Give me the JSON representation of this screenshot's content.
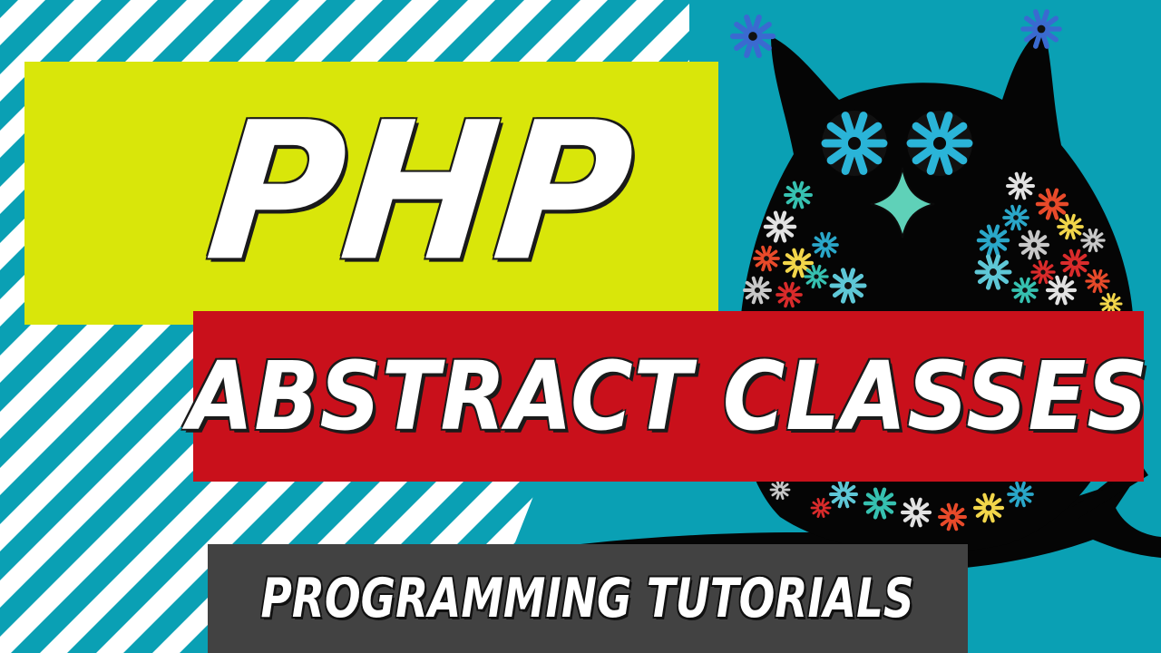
{
  "thumbnail": {
    "title_line1": "PHP",
    "title_line2": "ABSTRACT CLASSES",
    "subtitle": "PROGRAMMING TUTORIALS"
  },
  "colors": {
    "background": "#0aa0b4",
    "stripes": "#ffffff",
    "lime_panel": "#d9e60a",
    "red_panel": "#c9101b",
    "gray_panel": "#424242",
    "owl_body": "#050505",
    "owl_eye": "#2ab4d8",
    "owl_beak": "#5fd1b8"
  },
  "icons": {
    "mascot": "owl-icon",
    "decoration": "flower-icon"
  }
}
